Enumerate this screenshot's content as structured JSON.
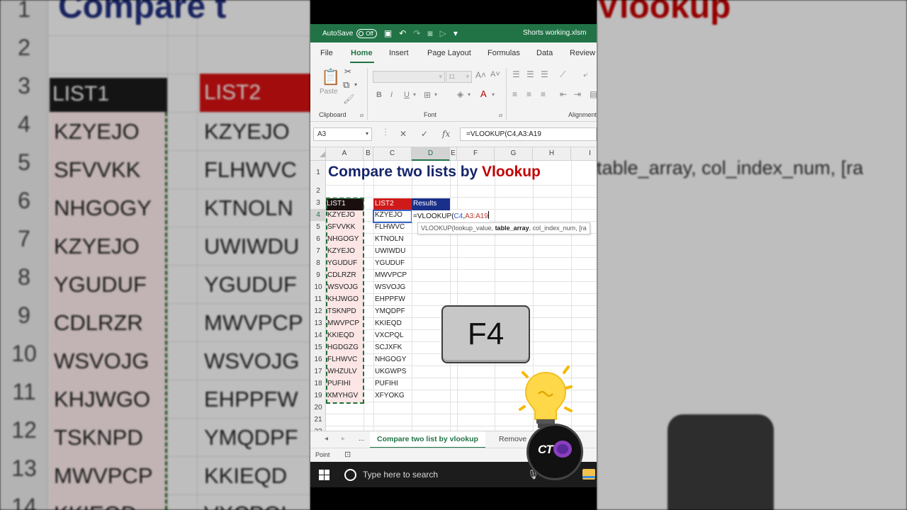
{
  "titlebar": {
    "autosave_label": "AutoSave",
    "toggle_state": "Off",
    "filename": "Shorts working.xlsm"
  },
  "tabs": [
    "File",
    "Home",
    "Insert",
    "Page Layout",
    "Formulas",
    "Data",
    "Review"
  ],
  "ribbon": {
    "paste": "Paste",
    "clipboard_group": "Clipboard",
    "font_group": "Font",
    "alignment_group": "Alignment",
    "font_size": "11",
    "bold": "B",
    "italic": "I",
    "underline": "U"
  },
  "formula_bar": {
    "name_box": "A3",
    "cancel": "✕",
    "enter": "✓",
    "fx": "fx",
    "formula": "=VLOOKUP(C4,A3:A19"
  },
  "columns": [
    "A",
    "B",
    "C",
    "D",
    "E",
    "F",
    "G",
    "H",
    "I"
  ],
  "rows": [
    "1",
    "2",
    "3",
    "4",
    "5",
    "6",
    "7",
    "8",
    "9",
    "10",
    "11",
    "12",
    "13",
    "14",
    "15",
    "16",
    "17",
    "18",
    "19",
    "20",
    "21",
    "22"
  ],
  "sheet": {
    "title_part1": "Compare two lists by ",
    "title_part2": "Vlookup",
    "list1_header": "LIST1",
    "list2_header": "LIST2",
    "results_header": "Results",
    "list1": [
      "KZYEJO",
      "SFVVKK",
      "NHGOGY",
      "KZYEJO",
      "YGUDUF",
      "CDLRZR",
      "WSVOJG",
      "KHJWGO",
      "TSKNPD",
      "MWVPCP",
      "KKIEQD",
      "HGDGZG",
      "FLHWVC",
      "WHZULV",
      "PUFIHI",
      "XMYHGV"
    ],
    "list2": [
      "KZYEJO",
      "FLHWVC",
      "KTNOLN",
      "UWIWDU",
      "YGUDUF",
      "MWVPCP",
      "WSVOJG",
      "EHPPFW",
      "YMQDPF",
      "KKIEQD",
      "VXCPQL",
      "SCJXFK",
      "NHGOGY",
      "UKGWPS",
      "PUFIHI",
      "XFYOKG"
    ],
    "edit_prefix": "=VLOOKUP(",
    "edit_ref1": "C4",
    "edit_comma": ",",
    "edit_ref2": "A3:A19",
    "tooltip_prefix": "VLOOKUP(lookup_value, ",
    "tooltip_bold": "table_array",
    "tooltip_suffix": ", col_index_num, [ra"
  },
  "keycap": "F4",
  "sheet_tabs": {
    "nav_prev": "◂",
    "nav_next": "▸",
    "more": "...",
    "active": "Compare two list by vlookup",
    "next": "Remove"
  },
  "status": {
    "mode": "Point"
  },
  "taskbar": {
    "search_placeholder": "Type here to search"
  },
  "watermark": {
    "text": "CT"
  },
  "background": {
    "title_left": "Compare t",
    "title_right": "Vlookup",
    "rows": [
      "1",
      "2",
      "3",
      "4",
      "5",
      "6",
      "7",
      "8",
      "9",
      "10",
      "11",
      "12",
      "13",
      "14"
    ],
    "list1": [
      "KZYEJO",
      "SFVVKK",
      "NHGOGY",
      "KZYEJO",
      "YGUDUF",
      "CDLRZR",
      "WSVOJG",
      "KHJWGO",
      "TSKNPD",
      "MWVPCP",
      "KKIEQD"
    ],
    "list2": [
      "KZYEJO",
      "FLHWVC",
      "KTNOLN",
      "UWIWDU",
      "YGUDUF",
      "MWVPCP",
      "WSVOJG",
      "EHPPFW",
      "YMQDPF",
      "KKIEQD",
      "VXCPQL"
    ],
    "list1_header": "LIST1",
    "list2_header": "LIST2",
    "hint": "table_array, col_index_num, [ra"
  },
  "colors": {
    "excel_green": "#217346",
    "title_navy": "#16256b",
    "title_red": "#c00000",
    "list2_red": "#d01a1a",
    "results_blue": "#1a2f8a"
  }
}
